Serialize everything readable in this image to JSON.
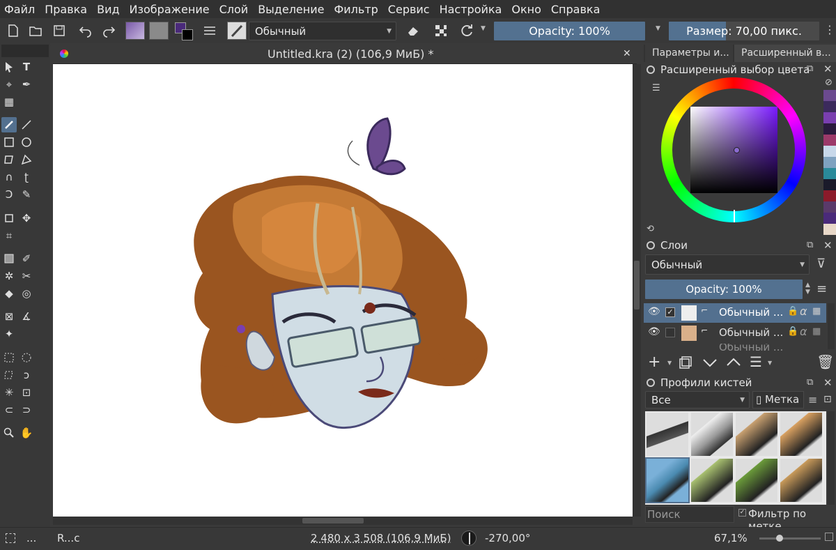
{
  "menu": [
    "Файл",
    "Правка",
    "Вид",
    "Изображение",
    "Слой",
    "Выделение",
    "Фильтр",
    "Сервис",
    "Настройка",
    "Окно",
    "Справка"
  ],
  "toolbar": {
    "blend_mode": "Обычный",
    "opacity": "Opacity: 100%",
    "size": "Размер: 70,00 пикс."
  },
  "document": {
    "tab_title": "Untitled.kra (2) (106,9 МиБ) *",
    "close": "✕"
  },
  "right_tabs": [
    "Параметры и...",
    "Расширенный в..."
  ],
  "color_docker": {
    "title": "Расширенный выбор цвета",
    "swatches": [
      "#6b4a8f",
      "#3b2a5c",
      "#7a3fb0",
      "#2a1a3d",
      "#9c3a6a",
      "#c8d8ea",
      "#7fa2c0",
      "#2a8a9a",
      "#1a1a2a",
      "#8b1a2a",
      "#5a3a6a",
      "#4a2a7a",
      "#e8d8c8"
    ]
  },
  "layers_docker": {
    "title": "Слои",
    "blend_mode": "Обычный",
    "opacity": "Opacity: 100%",
    "layers": [
      {
        "name": "Обычный ...",
        "selected": true
      },
      {
        "name": "Обычный ...",
        "selected": false
      },
      {
        "name": "Обычный ...",
        "selected": false
      }
    ]
  },
  "brushes_docker": {
    "title": "Профили кистей",
    "filter": "Все",
    "tag": "Метка",
    "search_placeholder": "Поиск",
    "filter_by_tag": "Фильтр по метке"
  },
  "status": {
    "tool": "...",
    "brush": "R...c",
    "dims": "2 480 x 3 508 (106,9 МиБ)",
    "rotation": "-270,00°",
    "zoom": "67,1%"
  }
}
